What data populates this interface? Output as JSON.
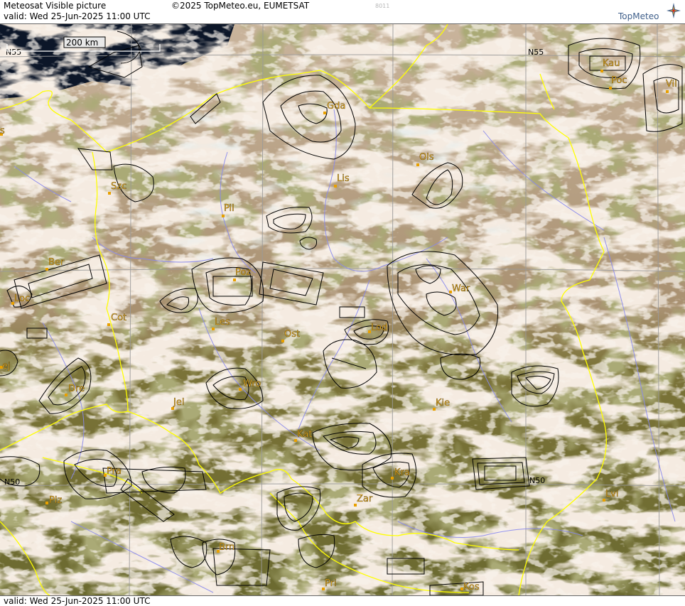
{
  "header": {
    "title": "Meteosat Visible picture",
    "copyright": "©2025 TopMeteo.eu, EUMETSAT",
    "valid": "valid:  Wed  25-Jun-2025  11:00 UTC",
    "code": "8011",
    "logo_text": "TopMeteo"
  },
  "footer": {
    "valid": "valid:  Wed  25-Jun-2025  11:00 UTC"
  },
  "scale": {
    "label": "200 km"
  },
  "latitude_labels": {
    "n55_left": "N55",
    "n55_right": "N55",
    "n50_left": "N50",
    "n50_right": "N50"
  },
  "cities": [
    {
      "name": "Kau"
    },
    {
      "name": "Poc"
    },
    {
      "name": "Vil"
    },
    {
      "name": "Gda"
    },
    {
      "name": "Ols"
    },
    {
      "name": "Lis"
    },
    {
      "name": "Szc"
    },
    {
      "name": "Pil"
    },
    {
      "name": "Ber"
    },
    {
      "name": "Poz"
    },
    {
      "name": "Loc"
    },
    {
      "name": "War"
    },
    {
      "name": "Cot"
    },
    {
      "name": "Les"
    },
    {
      "name": "Ost"
    },
    {
      "name": "Lod"
    },
    {
      "name": "Dre"
    },
    {
      "name": "Wro"
    },
    {
      "name": "Jel"
    },
    {
      "name": "Kie"
    },
    {
      "name": "Kat"
    },
    {
      "name": "Kra"
    },
    {
      "name": "Pra"
    },
    {
      "name": "Plz"
    },
    {
      "name": "Zar"
    },
    {
      "name": "Lvi"
    },
    {
      "name": "Brn"
    },
    {
      "name": "Pri"
    },
    {
      "name": "Kos"
    },
    {
      "name": "ej"
    },
    {
      "name": "s"
    }
  ],
  "colors": {
    "land": "#6e6b30",
    "cloud": "#e8d5be",
    "border": "#ffff00",
    "river": "#8888ee",
    "grid": "#9a9a9a",
    "city_marker": "#e8a000",
    "city_label": "#f0b428",
    "contour": "#000000",
    "sea": "#0c1628"
  }
}
